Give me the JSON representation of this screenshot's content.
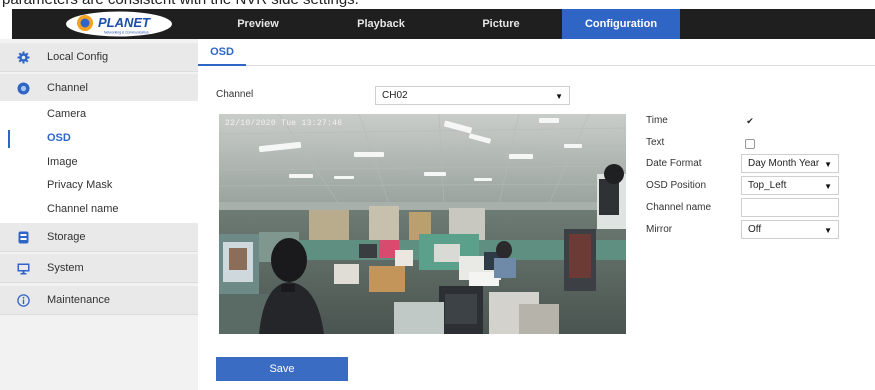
{
  "page_caption": "parameters are consistent with the NVR side settings.",
  "brand": {
    "name": "PLANET",
    "tagline": "Networking & Communication"
  },
  "top_nav": [
    {
      "label": "Preview",
      "active": false
    },
    {
      "label": "Playback",
      "active": false
    },
    {
      "label": "Picture",
      "active": false
    },
    {
      "label": "Configuration",
      "active": true
    }
  ],
  "sidebar": {
    "local_config": "Local Config",
    "channel": "Channel",
    "channel_items": [
      "Camera",
      "OSD",
      "Image",
      "Privacy Mask",
      "Channel name"
    ],
    "active_item": "OSD",
    "storage": "Storage",
    "system": "System",
    "maintenance": "Maintenance"
  },
  "tab": {
    "label": "OSD"
  },
  "form": {
    "channel_label": "Channel",
    "channel_value": "CH02",
    "time_label": "Time",
    "time_checked": true,
    "text_label": "Text",
    "text_checked": false,
    "date_format_label": "Date Format",
    "date_format_value": "Day Month Year",
    "osd_position_label": "OSD Position",
    "osd_position_value": "Top_Left",
    "channel_name_label": "Channel name",
    "channel_name_value": "",
    "mirror_label": "Mirror",
    "mirror_value": "Off",
    "checkmark_glyph": "✔"
  },
  "preview": {
    "timestamp": "22/10/2020 Tue 13:27:46"
  },
  "save_label": "Save",
  "colors": {
    "accent": "#2f66c6",
    "topbar": "#1f1f1f",
    "sidebar": "#f2f2f2"
  }
}
